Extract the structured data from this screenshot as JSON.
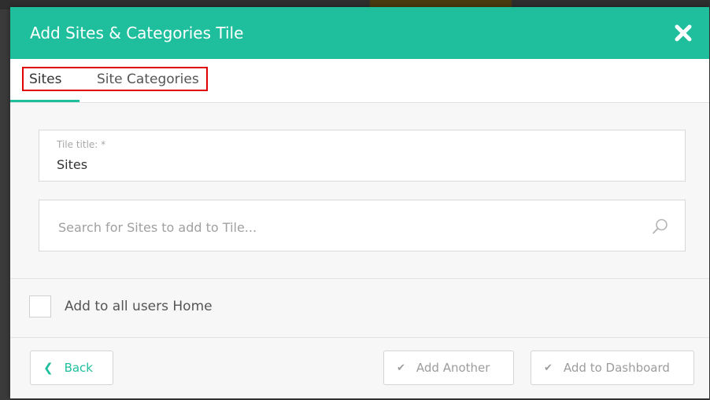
{
  "modal": {
    "title": "Add Sites & Categories Tile",
    "close_icon": "close-icon"
  },
  "tabs": [
    {
      "label": "Sites",
      "active": true
    },
    {
      "label": "Site Categories",
      "active": false
    }
  ],
  "form": {
    "tile_title_label": "Tile title: *",
    "tile_title_value": "Sites",
    "search_placeholder": "Search for Sites to add to Tile...",
    "search_icon": "search-icon"
  },
  "options": {
    "add_to_all_users_label": "Add to all users Home",
    "add_to_all_users_checked": false
  },
  "footer": {
    "back_label": "Back",
    "add_another_label": "Add Another",
    "add_to_dashboard_label": "Add to Dashboard"
  },
  "colors": {
    "accent": "#1fbf9d",
    "highlight": "#e00000"
  }
}
